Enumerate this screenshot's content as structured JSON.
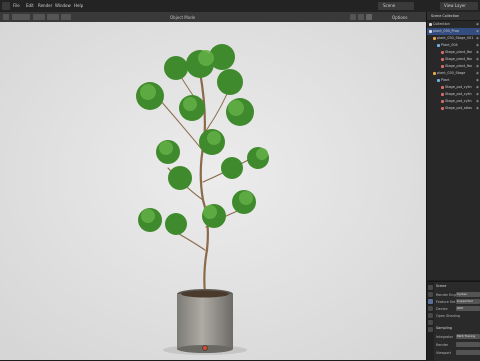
{
  "topbar": {
    "menus": [
      "File",
      "Edit",
      "Render",
      "Window",
      "Help"
    ],
    "view_label": "Scene",
    "view_right": "View Layer"
  },
  "viewport": {
    "header_mode": "Object Mode",
    "overlay_lines": [
      "User Perspective",
      "(1) Collection"
    ],
    "options_label": "Options"
  },
  "outliner": {
    "title": "Scene Collection",
    "rows": [
      {
        "label": "Collection",
        "kind": "collection",
        "sel": false
      },
      {
        "label": "plant_030_Prop",
        "kind": "collection",
        "sel": true
      },
      {
        "label": "plant_030_Stage_001",
        "kind": "object",
        "sel": false
      },
      {
        "label": "Plant_004",
        "kind": "mesh",
        "sel": false
      },
      {
        "label": "Stage_plant_fbx",
        "kind": "mat",
        "sel": false
      },
      {
        "label": "Stage_plant_fbx",
        "kind": "mat",
        "sel": false
      },
      {
        "label": "Stage_plant_fbx",
        "kind": "mat",
        "sel": false
      },
      {
        "label": "plant_030_Stage",
        "kind": "object",
        "sel": false
      },
      {
        "label": "Plant",
        "kind": "mesh",
        "sel": false
      },
      {
        "label": "Stage_pot_cylin",
        "kind": "mat",
        "sel": false
      },
      {
        "label": "Stage_pot_cylin",
        "kind": "mat",
        "sel": false
      },
      {
        "label": "Stage_pot_cylin",
        "kind": "mat",
        "sel": false
      },
      {
        "label": "Stage_pot_atlas",
        "kind": "mat",
        "sel": false
      }
    ]
  },
  "properties": {
    "panel_title": "Scene",
    "rows": [
      {
        "label": "Render Engine",
        "value": "Cycles"
      },
      {
        "label": "Feature Set",
        "value": "Supported"
      },
      {
        "label": "Device",
        "value": "GPU"
      },
      {
        "label": "Open Shading",
        "value": ""
      }
    ],
    "section": "Sampling",
    "section_rows": [
      {
        "label": "Integrator",
        "value": "Path Tracing"
      },
      {
        "label": "Render",
        "value": ""
      },
      {
        "label": "Viewport",
        "value": ""
      }
    ]
  },
  "colors": {
    "accent": "#334d80",
    "gizmo_x": "#e24d4d",
    "gizmo_y": "#6bb33a",
    "gizmo_z": "#4d7fe2",
    "gizmo_neg": "#8a8a8a"
  },
  "icons": [
    "menu-icon",
    "eye-icon",
    "camera-icon",
    "collection-icon",
    "mesh-icon",
    "material-icon",
    "render-icon",
    "scene-icon",
    "world-icon"
  ]
}
